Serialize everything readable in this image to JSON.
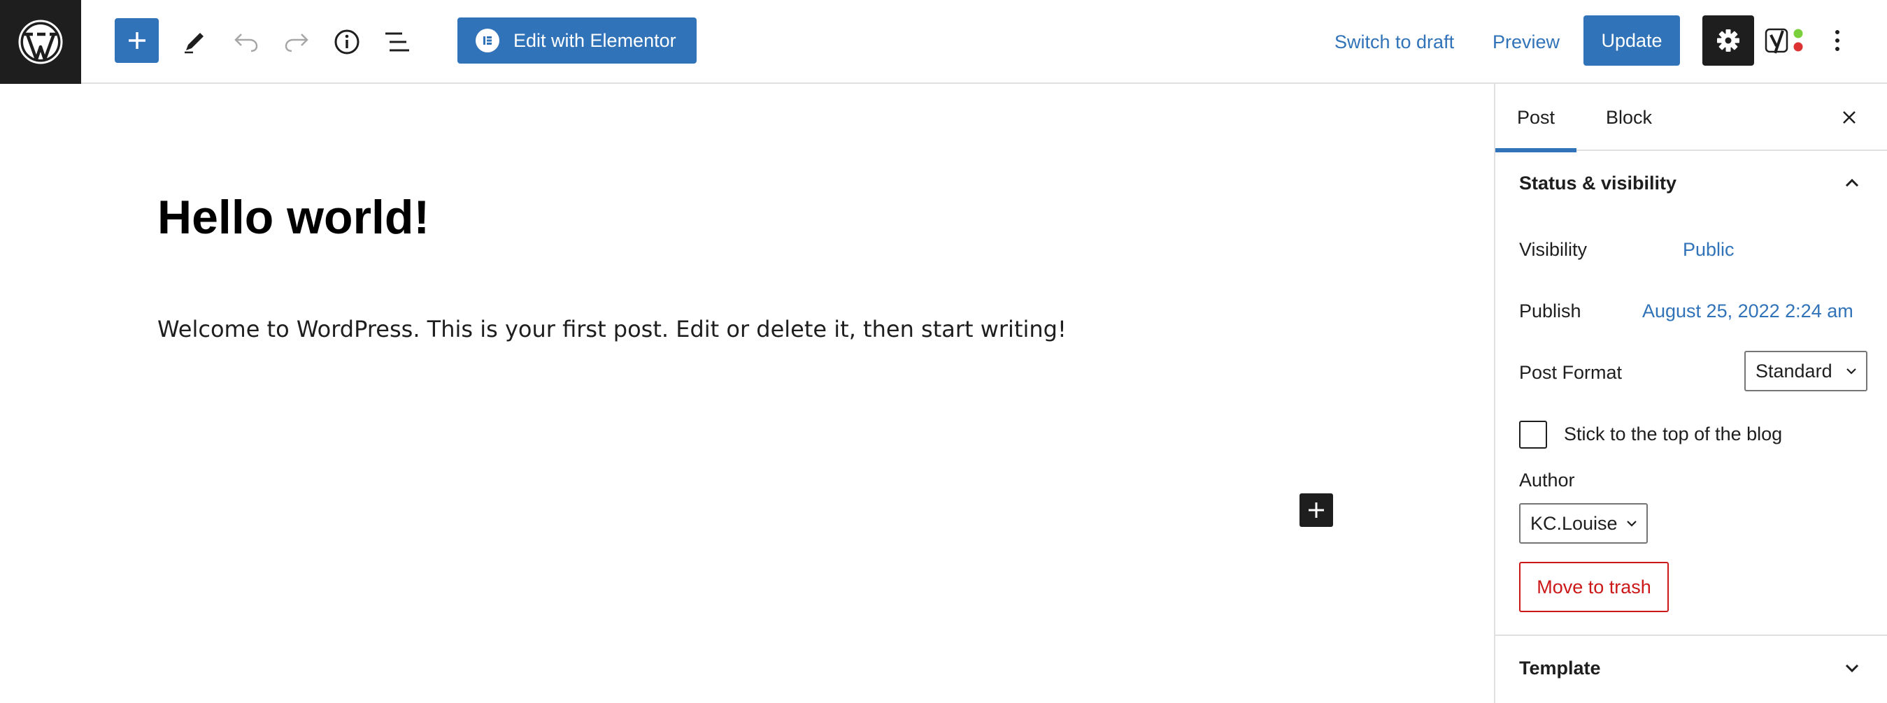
{
  "colors": {
    "accent": "#3173b8",
    "danger": "#cc1818",
    "dark": "#1e1e1e",
    "yoast_green": "#7ad03a",
    "yoast_red": "#dc3232"
  },
  "toolbar": {
    "logo_icon": "wordpress-logo-icon",
    "add_block_icon": "plus-icon",
    "tools_icon": "pencil-icon",
    "undo_icon": "undo-icon",
    "redo_icon": "redo-icon",
    "details_icon": "info-icon",
    "list_view_icon": "list-view-icon",
    "elementor_label": "Edit with Elementor",
    "switch_to_draft": "Switch to draft",
    "preview": "Preview",
    "update": "Update",
    "settings_icon": "gear-icon",
    "yoast_icon": "yoast-icon",
    "more_icon": "more-vertical-icon"
  },
  "editor": {
    "title": "Hello world!",
    "paragraph": "Welcome to WordPress. This is your first post. Edit or delete it, then start writing!",
    "inline_add_icon": "plus-icon"
  },
  "sidebar": {
    "tabs": [
      {
        "label": "Post",
        "active": true
      },
      {
        "label": "Block",
        "active": false
      }
    ],
    "close_icon": "close-icon",
    "status_panel": {
      "title": "Status & visibility",
      "expanded": true,
      "visibility_label": "Visibility",
      "visibility_value": "Public",
      "publish_label": "Publish",
      "publish_value": "August 25, 2022 2:24 am",
      "format_label": "Post Format",
      "format_value": "Standard",
      "sticky_label": "Stick to the top of the blog",
      "sticky_checked": false,
      "author_label": "Author",
      "author_value": "KC.Louise",
      "trash_label": "Move to trash"
    },
    "template_panel": {
      "title": "Template",
      "expanded": false
    }
  }
}
